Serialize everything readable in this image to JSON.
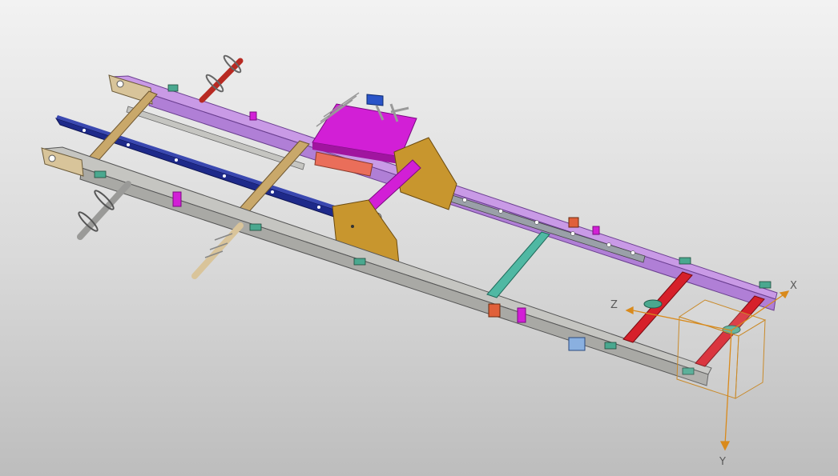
{
  "viewport": {
    "background_top": "#f2f2f2",
    "background_bottom": "#bdbdbd"
  },
  "colors": {
    "rail_gray": "#a9a9a5",
    "rail_gray_dark": "#6f6f6a",
    "rail_lilac": "#b07fd6",
    "rail_lilac_dark": "#7a4fa0",
    "beam_navy": "#1e2a8a",
    "strap_tan": "#c9a86a",
    "gusset_gold": "#c8962e",
    "plate_magenta": "#d21fd6",
    "crossbar_teal": "#4fb8a3",
    "crossbar_red": "#d6202a",
    "clip_teal": "#4aa88f",
    "axis_orange": "#d98a1c",
    "box_outline": "#c98a2a"
  },
  "triad": {
    "x_label": "X",
    "y_label": "Y",
    "z_label": "Z"
  }
}
